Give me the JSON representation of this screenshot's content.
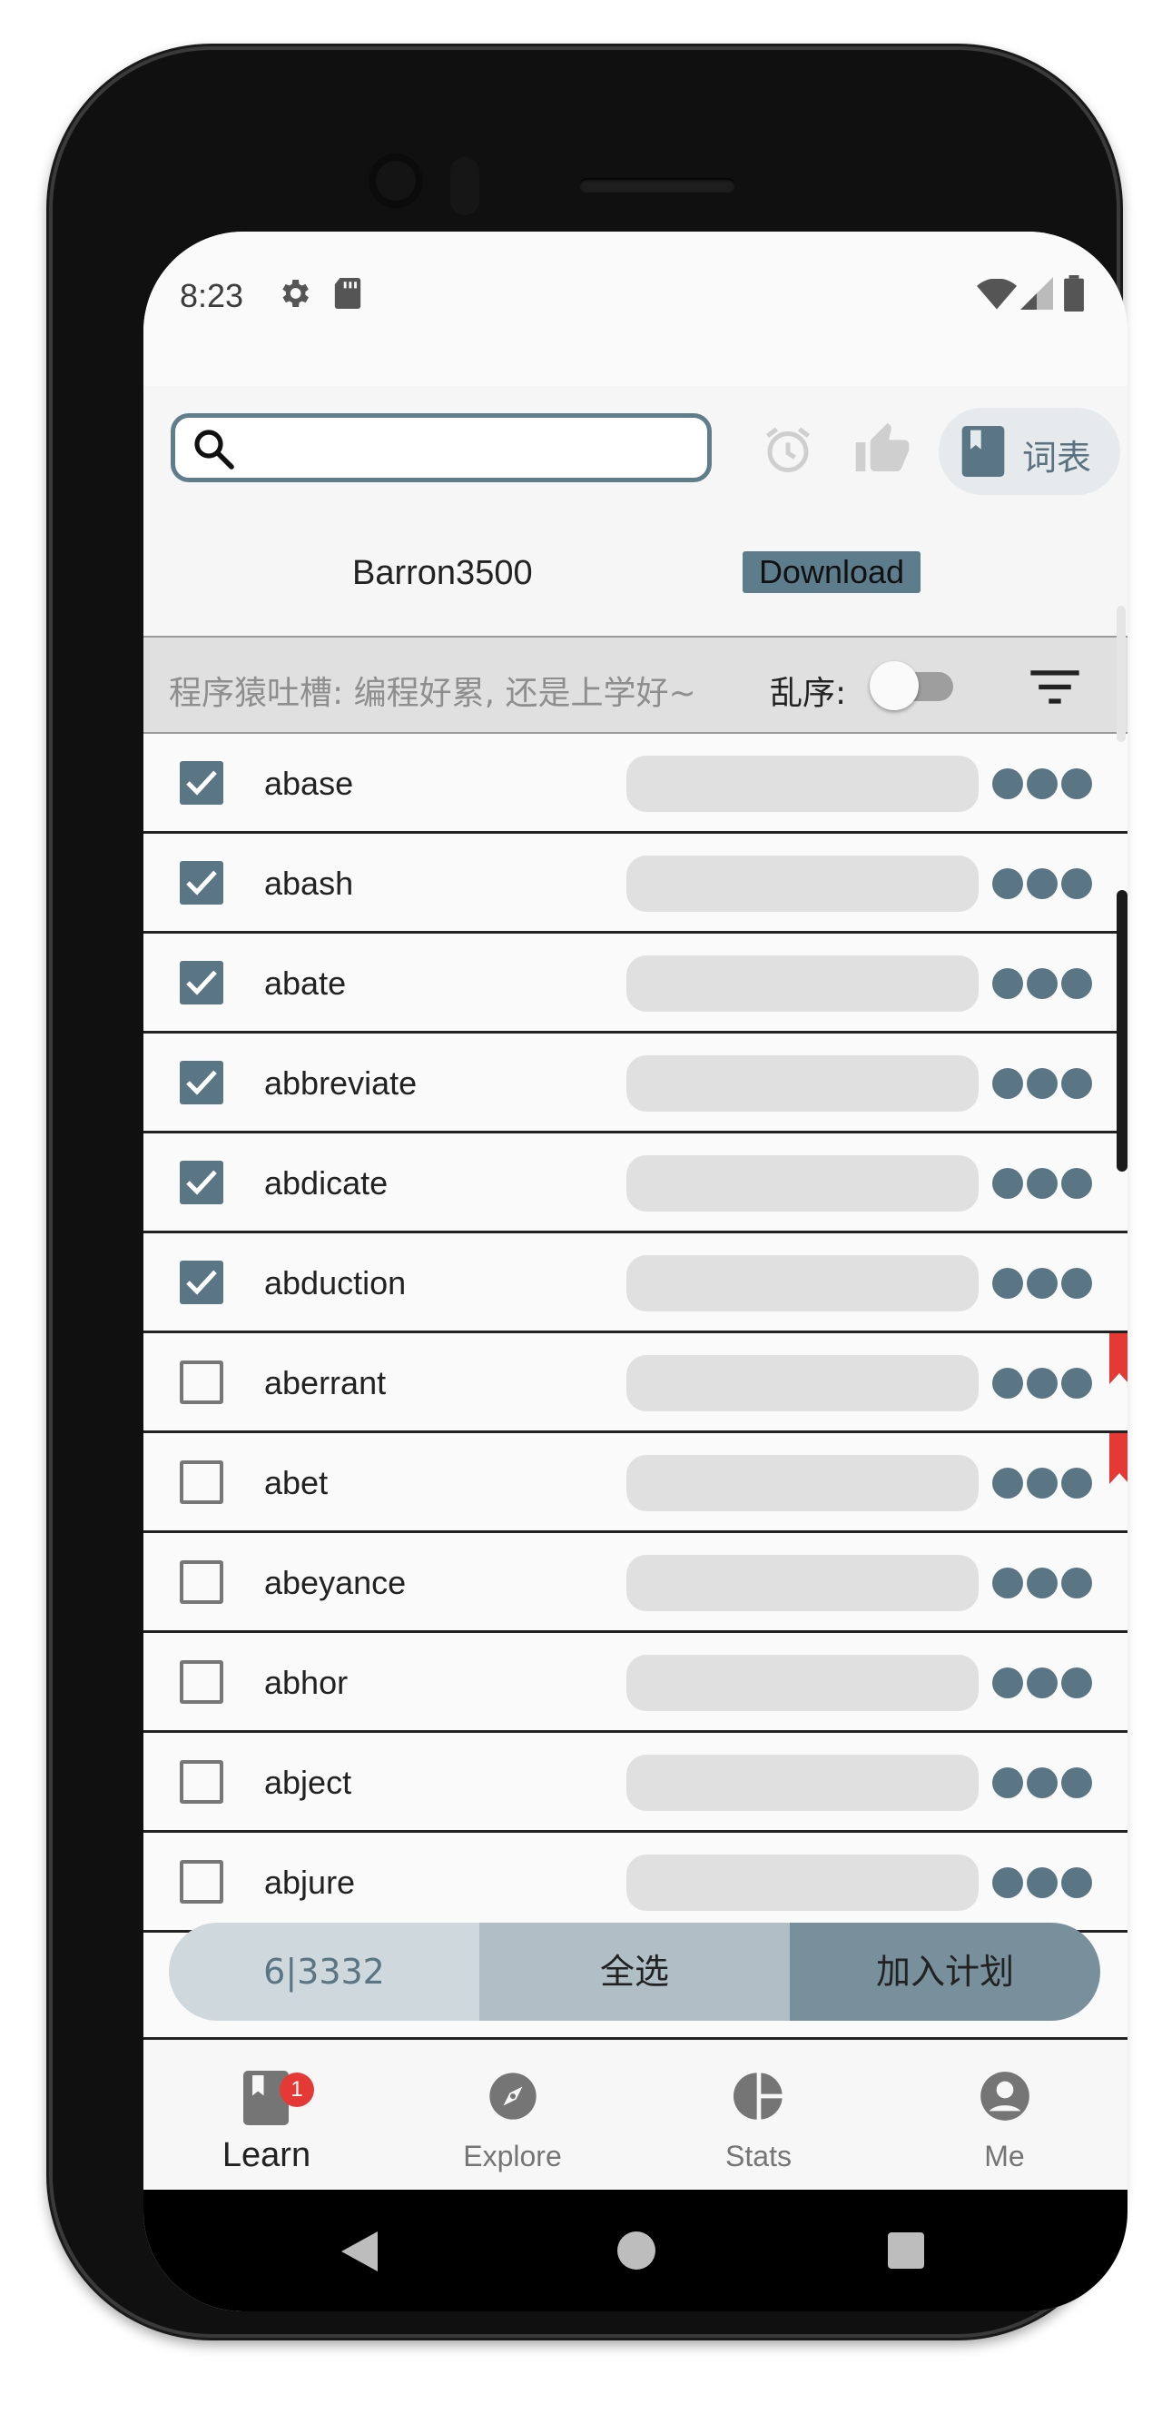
{
  "status_bar": {
    "time": "8:23",
    "icons": [
      "settings-gear-icon",
      "sd-card-icon",
      "wifi-icon",
      "cell-signal-icon",
      "battery-icon"
    ]
  },
  "toolbar": {
    "search": {
      "value": "",
      "placeholder": ""
    },
    "icons": [
      "alarm-icon",
      "thumbs-up-icon"
    ],
    "vocab_button_label": "词表",
    "book_name": "Barron3500",
    "download_label": "Download"
  },
  "filter_bar": {
    "tip": "程序猿吐槽: 编程好累, 还是上学好~",
    "shuffle_label": "乱序:",
    "shuffle_on": false
  },
  "words": [
    {
      "word": "abase",
      "checked": true,
      "bookmarked": false
    },
    {
      "word": "abash",
      "checked": true,
      "bookmarked": false
    },
    {
      "word": "abate",
      "checked": true,
      "bookmarked": false
    },
    {
      "word": "abbreviate",
      "checked": true,
      "bookmarked": false
    },
    {
      "word": "abdicate",
      "checked": true,
      "bookmarked": false
    },
    {
      "word": "abduction",
      "checked": true,
      "bookmarked": false
    },
    {
      "word": "aberrant",
      "checked": false,
      "bookmarked": true
    },
    {
      "word": "abet",
      "checked": false,
      "bookmarked": true
    },
    {
      "word": "abeyance",
      "checked": false,
      "bookmarked": false
    },
    {
      "word": "abhor",
      "checked": false,
      "bookmarked": false
    },
    {
      "word": "abject",
      "checked": false,
      "bookmarked": false
    },
    {
      "word": "abjure",
      "checked": false,
      "bookmarked": false
    }
  ],
  "action_bar": {
    "count": "6|3332",
    "select_all": "全选",
    "add_to_plan": "加入计划"
  },
  "bottom_nav": {
    "items": [
      {
        "label": "Learn",
        "icon": "bookmark-book-icon",
        "badge": "1",
        "active": true
      },
      {
        "label": "Explore",
        "icon": "compass-icon",
        "active": false
      },
      {
        "label": "Stats",
        "icon": "pie-chart-icon",
        "active": false
      },
      {
        "label": "Me",
        "icon": "account-circle-icon",
        "active": false
      }
    ]
  },
  "colors": {
    "primary": "#5a7584",
    "accent_red": "#e53935",
    "progress_bar": "#e0e0e0"
  }
}
